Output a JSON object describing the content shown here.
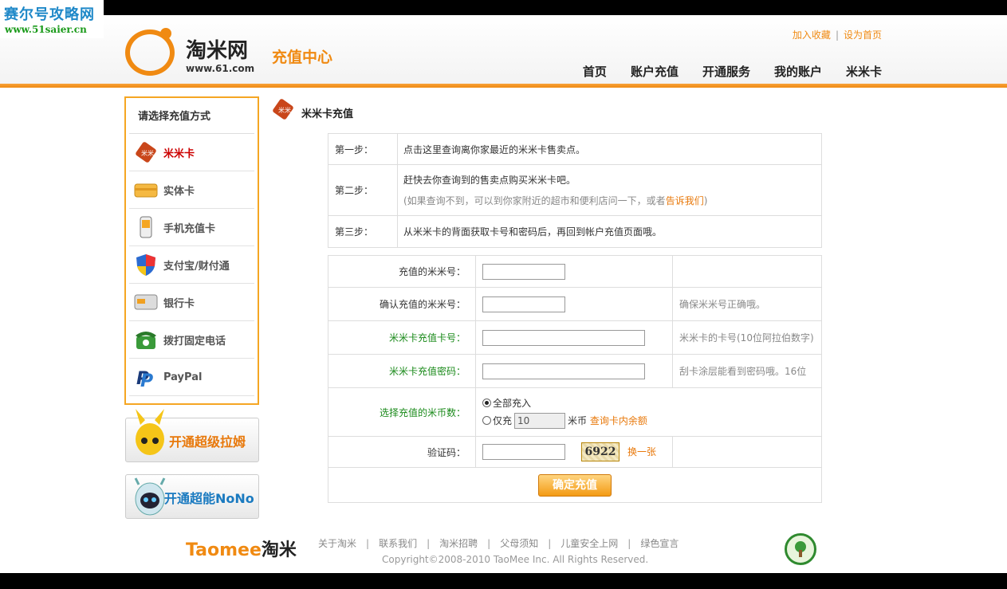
{
  "watermark": {
    "title": "赛尔号攻略网",
    "url": "www.51saier.cn"
  },
  "header": {
    "logo_name": "淘米网",
    "logo_url": "www.61.com",
    "logo_sub": "充值中心",
    "top_links": [
      "加入收藏",
      "设为首页"
    ],
    "nav": [
      "首页",
      "账户充值",
      "开通服务",
      "我的账户",
      "米米卡"
    ]
  },
  "sidebar": {
    "title": "请选择充值方式",
    "items": [
      {
        "label": "米米卡",
        "icon": "mimi-card-tag-icon"
      },
      {
        "label": "实体卡",
        "icon": "physical-card-icon"
      },
      {
        "label": "手机充值卡",
        "icon": "mobile-phone-icon"
      },
      {
        "label": "支付宝/财付通",
        "icon": "shield-icon"
      },
      {
        "label": "银行卡",
        "icon": "bank-card-icon"
      },
      {
        "label": "拨打固定电话",
        "icon": "telephone-icon"
      },
      {
        "label": "PayPal",
        "icon": "paypal-icon"
      }
    ],
    "promos": [
      "开通超级拉姆",
      "开通超能NoNo"
    ]
  },
  "main": {
    "section_title": "米米卡充值",
    "steps": [
      {
        "key": "第一步：",
        "text": "点击这里查询离你家最近的米米卡售卖点。"
      },
      {
        "key": "第二步：",
        "text": "赶快去你查询到的售卖点购买米米卡吧。",
        "note_prefix": "(如果查询不到，可以到你家附近的超市和便利店问一下，或者",
        "note_link": "告诉我们",
        "note_suffix": ")"
      },
      {
        "key": "第三步：",
        "text": "从米米卡的背面获取卡号和密码后，再回到帐户充值页面哦。"
      }
    ],
    "form": {
      "rows": [
        {
          "label": "充值的米米号：",
          "hint": ""
        },
        {
          "label": "确认充值的米米号：",
          "hint": "确保米米号正确哦。"
        },
        {
          "label": "米米卡充值卡号：",
          "hint": "米米卡的卡号(10位阿拉伯数字)"
        },
        {
          "label": "米米卡充值密码：",
          "hint": "刮卡涂层能看到密码哦。16位"
        }
      ],
      "amount_label": "选择充值的米币数：",
      "amount_all": "全部充入",
      "amount_only": "仅充",
      "amount_value": "10",
      "amount_unit": "米币",
      "amount_link": "查询卡内余额",
      "captcha_label": "验证码：",
      "captcha_code": "6922",
      "captcha_refresh": "换一张",
      "submit": "确定充值"
    }
  },
  "footer": {
    "logo": "Taomee淘米",
    "links": [
      "关于淘米",
      "联系我们",
      "淘米招聘",
      "父母须知",
      "儿童安全上网",
      "绿色宣言"
    ],
    "copyright": "Copyright©2008-2010 TaoMee Inc. All Rights Reserved."
  },
  "colors": {
    "accent": "#f08a12",
    "green": "#1a8a1a",
    "active": "#cc0000"
  }
}
